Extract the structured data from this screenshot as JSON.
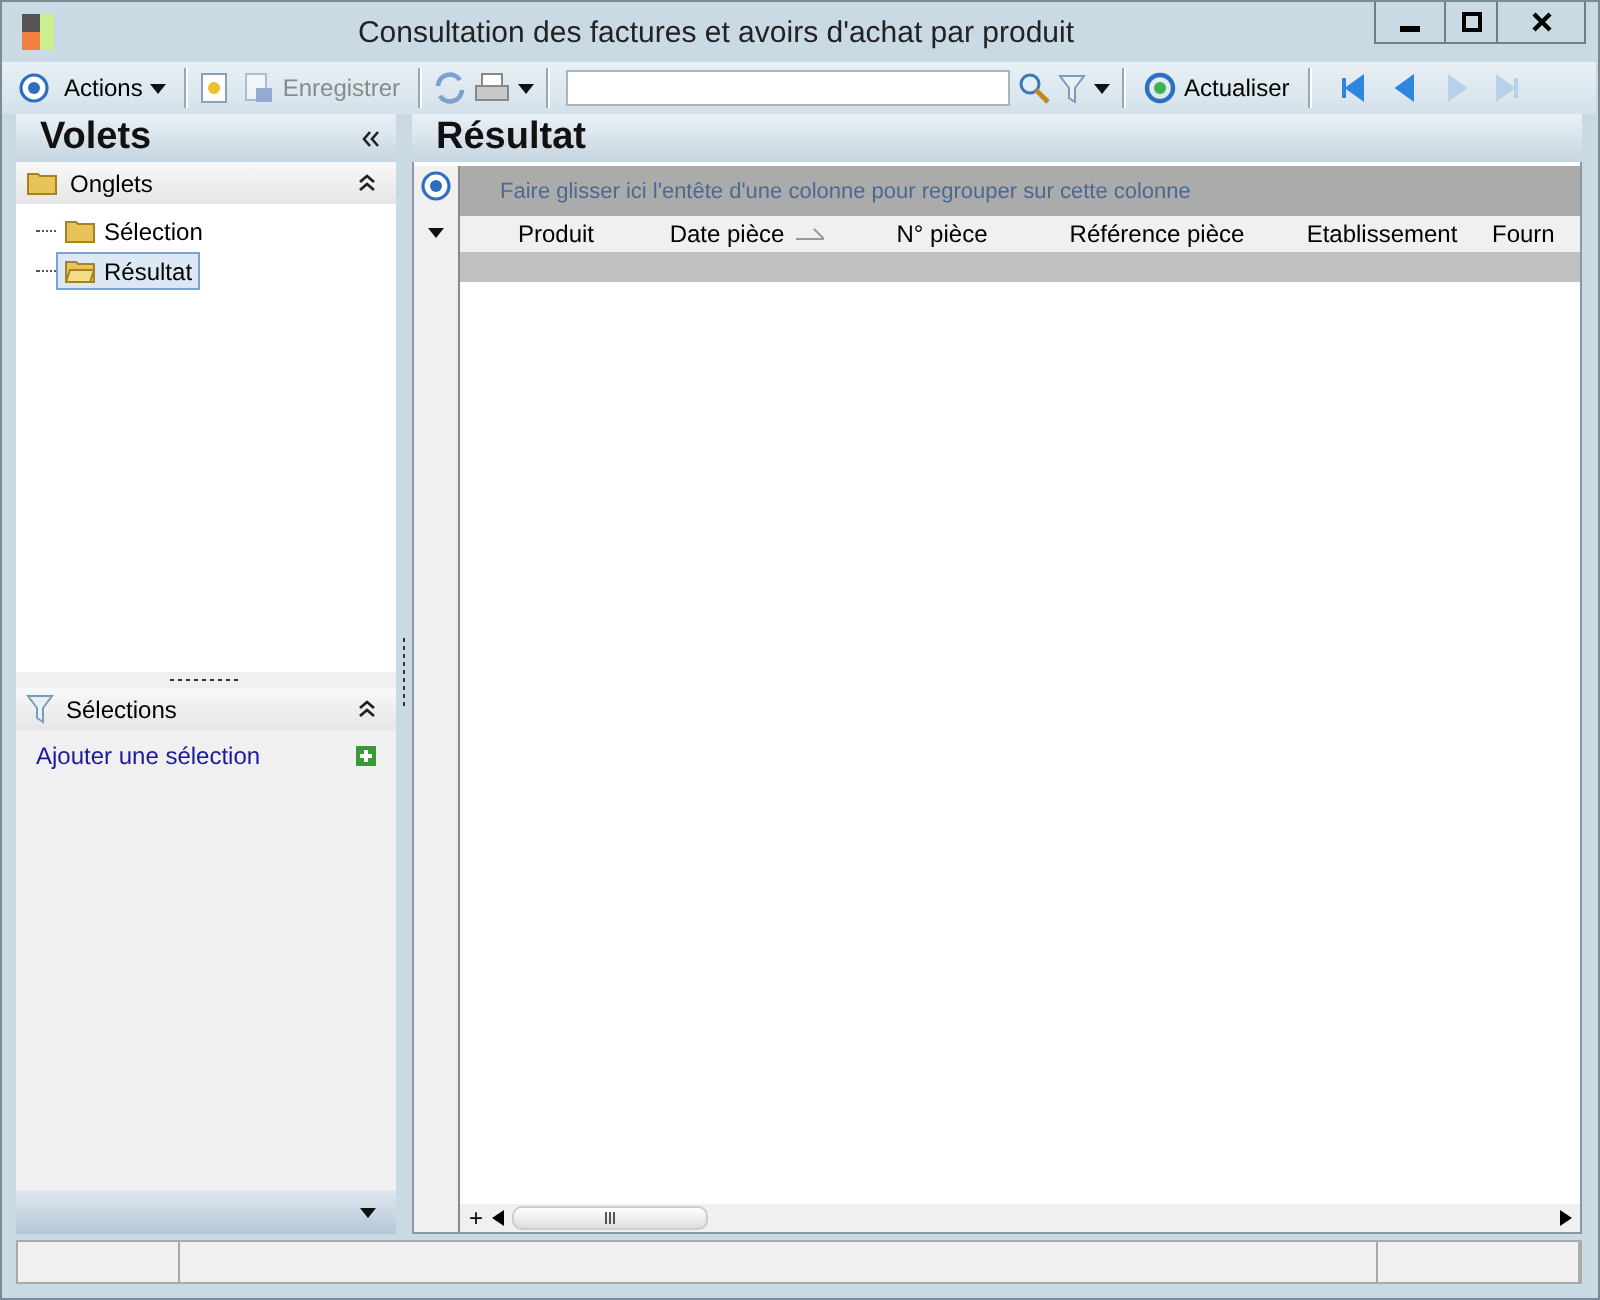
{
  "window": {
    "title": "Consultation des factures et avoirs d'achat par produit"
  },
  "toolbar": {
    "actions_label": "Actions",
    "save": {
      "label": "Enregistrer",
      "disabled": true
    },
    "refresh_label": "Actualiser",
    "nav": [
      {
        "disabled": false
      },
      {
        "disabled": false
      },
      {
        "disabled": true
      },
      {
        "disabled": true
      }
    ]
  },
  "panes": {
    "title": "Volets",
    "tabs_section": {
      "title": "Onglets",
      "expanded": true,
      "items": [
        {
          "label": "Sélection",
          "selected": false
        },
        {
          "label": "Résultat",
          "selected": true
        }
      ]
    },
    "selections_section": {
      "title": "Sélections",
      "expanded": true,
      "link": "Ajouter une sélection"
    }
  },
  "result": {
    "title": "Résultat",
    "add_row_label": "+",
    "group_hint": "Faire glisser ici l'entête d'une colonne pour regrouper sur cette colonne",
    "columns": [
      {
        "label": "Produit",
        "sorted": false
      },
      {
        "label": "Date pièce",
        "sorted": true
      },
      {
        "label": "N° pièce",
        "sorted": false
      },
      {
        "label": "Référence pièce",
        "sorted": false
      },
      {
        "label": "Etablissement",
        "sorted": false
      },
      {
        "label": "Fourn",
        "sorted": false
      }
    ]
  }
}
